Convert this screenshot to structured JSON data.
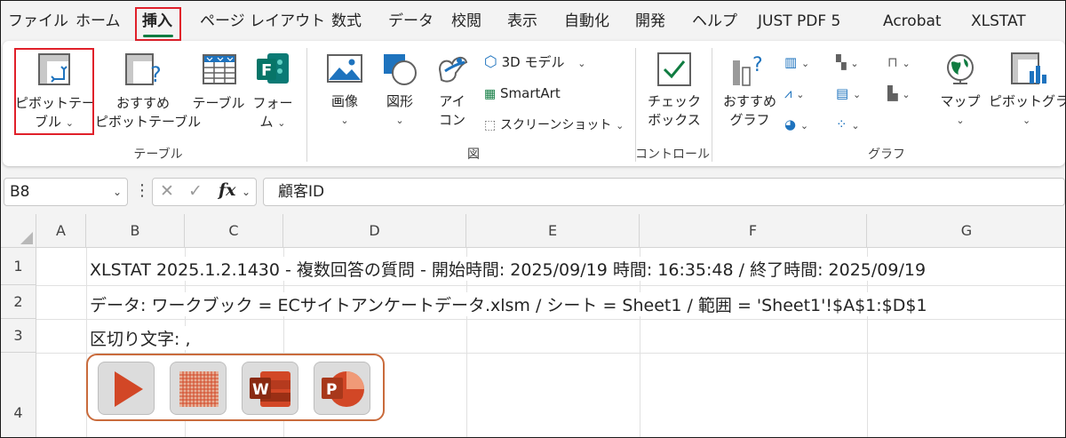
{
  "tabs": [
    "ファイル",
    "ホーム",
    "挿入",
    "ページ レイアウト",
    "数式",
    "データ",
    "校閲",
    "表示",
    "自動化",
    "開発",
    "ヘルプ",
    "JUST PDF 5",
    "Acrobat",
    "XLSTAT"
  ],
  "ribbon": {
    "pivot_table": {
      "line1": "ピボットテー",
      "line2": "ブル"
    },
    "recommended_pivot": {
      "line1": "おすすめ",
      "line2": "ピボットテーブル"
    },
    "table": "テーブル",
    "forms": {
      "line1": "フォー",
      "line2": "ム"
    },
    "group_table": "テーブル",
    "image": "画像",
    "shapes": "図形",
    "icons": {
      "line1": "アイ",
      "line2": "コン"
    },
    "model3d": "3D モデル",
    "smartart": "SmartArt",
    "screenshot": "スクリーンショット",
    "group_figure": "図",
    "checkbox": {
      "line1": "チェック",
      "line2": "ボックス"
    },
    "group_control": "コントロール",
    "recommended_chart": {
      "line1": "おすすめ",
      "line2": "グラフ"
    },
    "map": "マップ",
    "pivot_chart": "ピボットグラフ",
    "group_chart": "グラフ"
  },
  "formula_bar": {
    "name_box": "B8",
    "fx": "fx",
    "formula": "顧客ID"
  },
  "sheet": {
    "columns": [
      "A",
      "B",
      "C",
      "D",
      "E",
      "F",
      "G"
    ],
    "rows": [
      "1",
      "2",
      "3",
      "4"
    ],
    "cells": {
      "B1": "XLSTAT 2025.1.2.1430 - 複数回答の質問 - 開始時間: 2025/09/19 時間: 16:35:48 / 終了時間: 2025/09/19",
      "B2": "データ: ワークブック = ECサイトアンケートデータ.xlsm / シート = Sheet1 / 範囲 = 'Sheet1'!$A$1:$D$1",
      "B3": "区切り文字: ,"
    }
  },
  "colors": {
    "accent_green": "#107c41",
    "highlight_red": "#e0202a",
    "xlstat_orange": "#d24726"
  }
}
